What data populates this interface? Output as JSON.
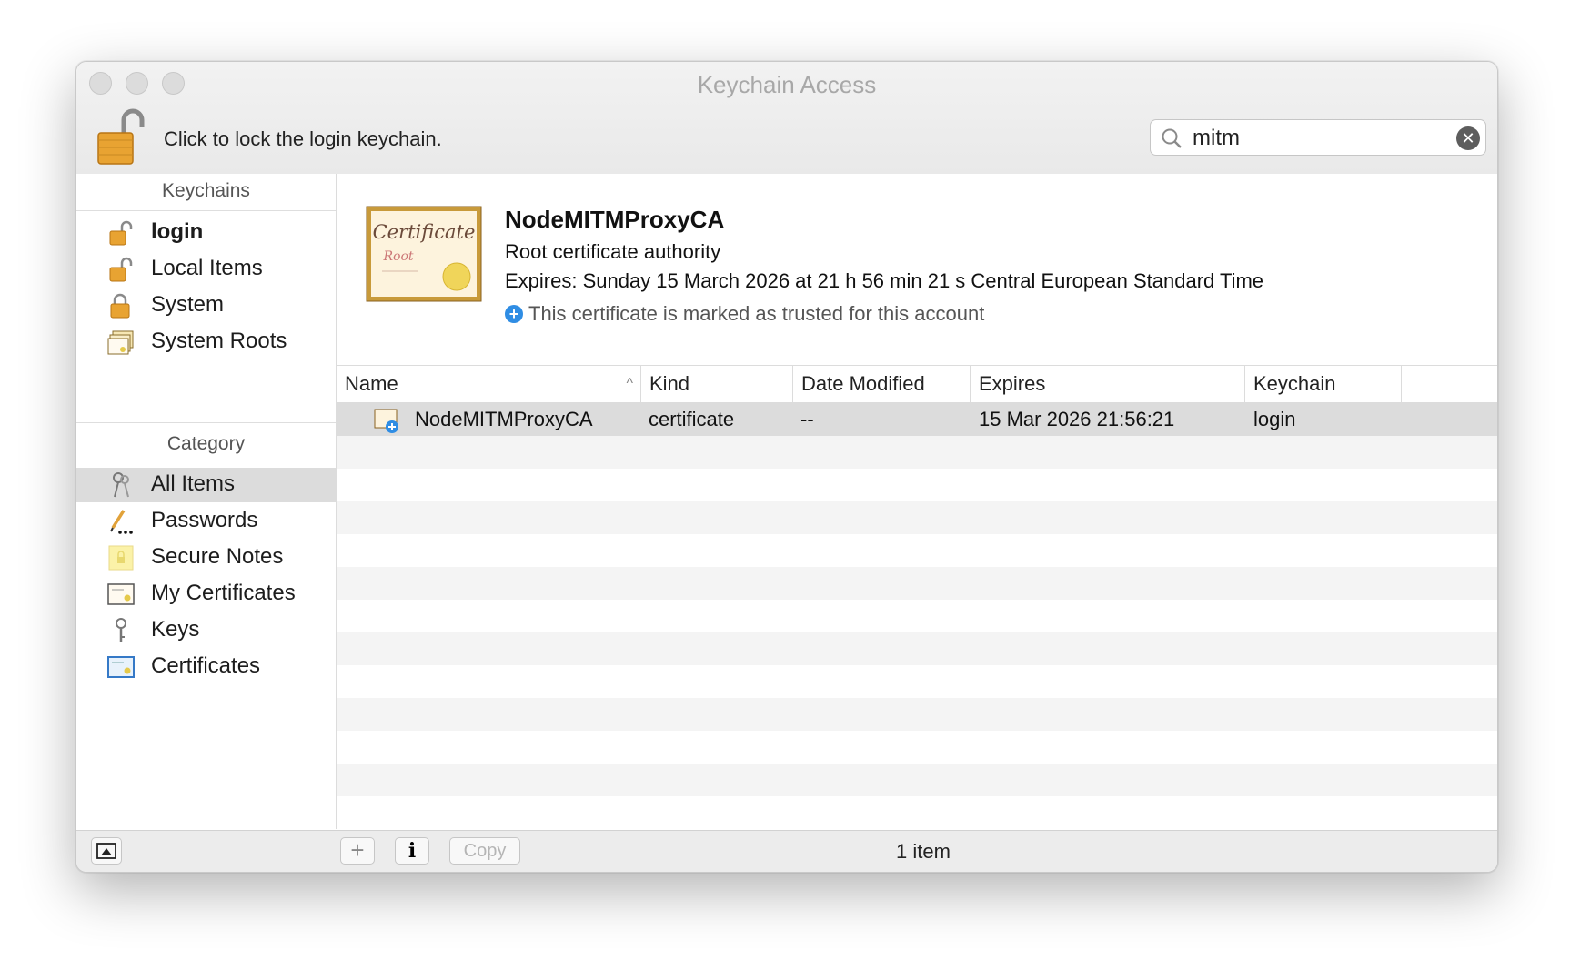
{
  "window": {
    "title": "Keychain Access",
    "lock_message": "Click to lock the login keychain."
  },
  "search": {
    "value": "mitm"
  },
  "sidebar": {
    "keychains_heading": "Keychains",
    "keychains": [
      {
        "label": "login",
        "icon": "unlocked-padlock-icon",
        "bold": true
      },
      {
        "label": "Local Items",
        "icon": "unlocked-padlock-icon"
      },
      {
        "label": "System",
        "icon": "locked-padlock-icon"
      },
      {
        "label": "System Roots",
        "icon": "certificate-stack-icon"
      }
    ],
    "category_heading": "Category",
    "categories": [
      {
        "label": "All Items",
        "icon": "keys-icon",
        "selected": true
      },
      {
        "label": "Passwords",
        "icon": "pencil-dots-icon"
      },
      {
        "label": "Secure Notes",
        "icon": "note-icon"
      },
      {
        "label": "My Certificates",
        "icon": "certificate-person-icon"
      },
      {
        "label": "Keys",
        "icon": "key-icon"
      },
      {
        "label": "Certificates",
        "icon": "certificate-icon"
      }
    ]
  },
  "detail": {
    "name": "NodeMITMProxyCA",
    "kind": "Root certificate authority",
    "expires": "Expires: Sunday 15 March 2026 at 21 h 56 min 21 s Central European Standard Time",
    "trust": "This certificate is marked as trusted for this account",
    "cert_image_text_1": "Certificate",
    "cert_image_text_2": "Root"
  },
  "table": {
    "columns": [
      "Name",
      "Kind",
      "Date Modified",
      "Expires",
      "Keychain"
    ],
    "rows": [
      {
        "name": "NodeMITMProxyCA",
        "kind": "certificate",
        "date_modified": "--",
        "expires": "15 Mar 2026 21:56:21",
        "keychain": "login"
      }
    ]
  },
  "bottombar": {
    "copy_label": "Copy",
    "info_label": "i",
    "add_label": "+",
    "status": "1 item"
  },
  "colors": {
    "accent_blue": "#2f8de4",
    "selection": "#dcdcdc",
    "lock_orange": "#e8a332"
  }
}
